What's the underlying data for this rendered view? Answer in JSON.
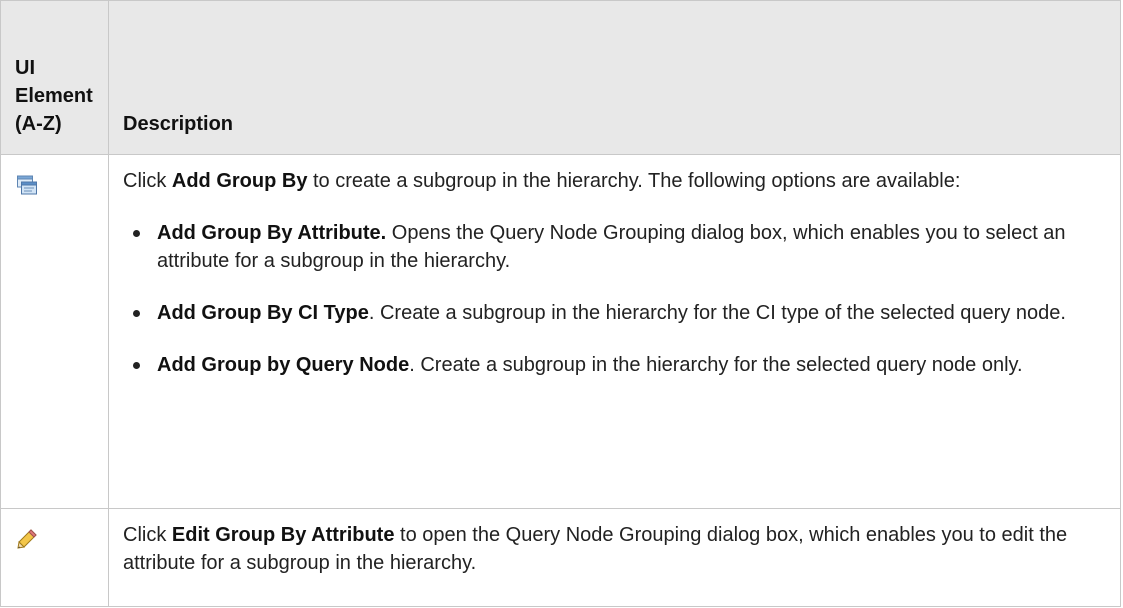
{
  "header": {
    "col_ui_lines": [
      "UI",
      "Element",
      "(A-Z)"
    ],
    "col_description": "Description"
  },
  "rows": [
    {
      "icon": "add-group-by-icon",
      "intro": {
        "before": "Click ",
        "bold": "Add Group By",
        "after": " to create a subgroup in the hierarchy. The following options are available:"
      },
      "options": [
        {
          "bold": "Add Group By Attribute.",
          "text": " Opens the Query Node Grouping dialog box, which enables you to select an attribute for a subgroup in the hierarchy."
        },
        {
          "bold": "Add Group By CI Type",
          "text": ". Create a subgroup in the hierarchy for the CI type of the selected query node."
        },
        {
          "bold": "Add Group by Query Node",
          "text": ". Create a subgroup in the hierarchy for the selected query node only."
        }
      ]
    },
    {
      "icon": "pencil-edit-icon",
      "intro": {
        "before": "Click ",
        "bold": "Edit Group By Attribute",
        "after": " to open the Query Node Grouping dialog box, which enables you to edit the attribute for a subgroup in the hierarchy."
      }
    }
  ]
}
